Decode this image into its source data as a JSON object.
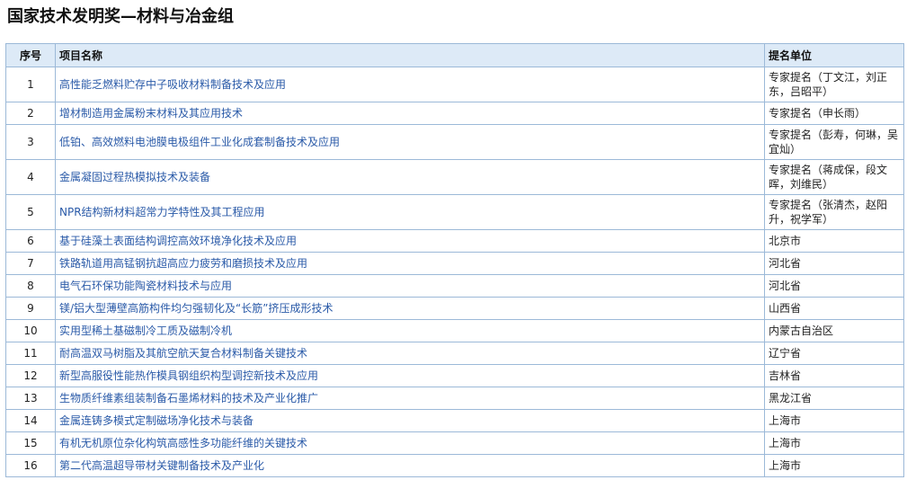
{
  "page": {
    "title": "国家技术发明奖—材料与冶金组"
  },
  "table": {
    "headers": {
      "no": "序号",
      "name": "项目名称",
      "unit": "提名单位"
    },
    "rows": [
      {
        "no": "1",
        "name": "高性能乏燃料贮存中子吸收材料制备技术及应用",
        "unit": "专家提名（丁文江，刘正东，吕昭平）",
        "tall": true
      },
      {
        "no": "2",
        "name": "增材制造用金属粉末材料及其应用技术",
        "unit": "专家提名（申长雨）",
        "tall": false
      },
      {
        "no": "3",
        "name": "低铂、高效燃料电池膜电极组件工业化成套制备技术及应用",
        "unit": "专家提名（彭寿，何琳，吴宜灿）",
        "tall": true
      },
      {
        "no": "4",
        "name": "金属凝固过程热模拟技术及装备",
        "unit": "专家提名（蒋成保，段文晖，刘维民）",
        "tall": true
      },
      {
        "no": "5",
        "name": "NPR结构新材料超常力学特性及其工程应用",
        "unit": "专家提名（张清杰，赵阳升，祝学军）",
        "tall": true
      },
      {
        "no": "6",
        "name": "基于硅藻土表面结构调控高效环境净化技术及应用",
        "unit": "北京市",
        "tall": false
      },
      {
        "no": "7",
        "name": "铁路轨道用高锰钢抗超高应力疲劳和磨损技术及应用",
        "unit": "河北省",
        "tall": false
      },
      {
        "no": "8",
        "name": "电气石环保功能陶瓷材料技术与应用",
        "unit": "河北省",
        "tall": false
      },
      {
        "no": "9",
        "name": "镁/铝大型薄壁高筋构件均匀强韧化及“长筋”挤压成形技术",
        "unit": "山西省",
        "tall": false
      },
      {
        "no": "10",
        "name": "实用型稀土基磁制冷工质及磁制冷机",
        "unit": "内蒙古自治区",
        "tall": false
      },
      {
        "no": "11",
        "name": "耐高温双马树脂及其航空航天复合材料制备关键技术",
        "unit": "辽宁省",
        "tall": false
      },
      {
        "no": "12",
        "name": "新型高服役性能热作模具钢组织构型调控新技术及应用",
        "unit": "吉林省",
        "tall": false
      },
      {
        "no": "13",
        "name": "生物质纤维素组装制备石墨烯材料的技术及产业化推广",
        "unit": "黑龙江省",
        "tall": false
      },
      {
        "no": "14",
        "name": "金属连铸多模式定制磁场净化技术与装备",
        "unit": "上海市",
        "tall": false
      },
      {
        "no": "15",
        "name": "有机无机原位杂化构筑高感性多功能纤维的关键技术",
        "unit": "上海市",
        "tall": false
      },
      {
        "no": "16",
        "name": "第二代高温超导带材关键制备技术及产业化",
        "unit": "上海市",
        "tall": false
      }
    ]
  }
}
